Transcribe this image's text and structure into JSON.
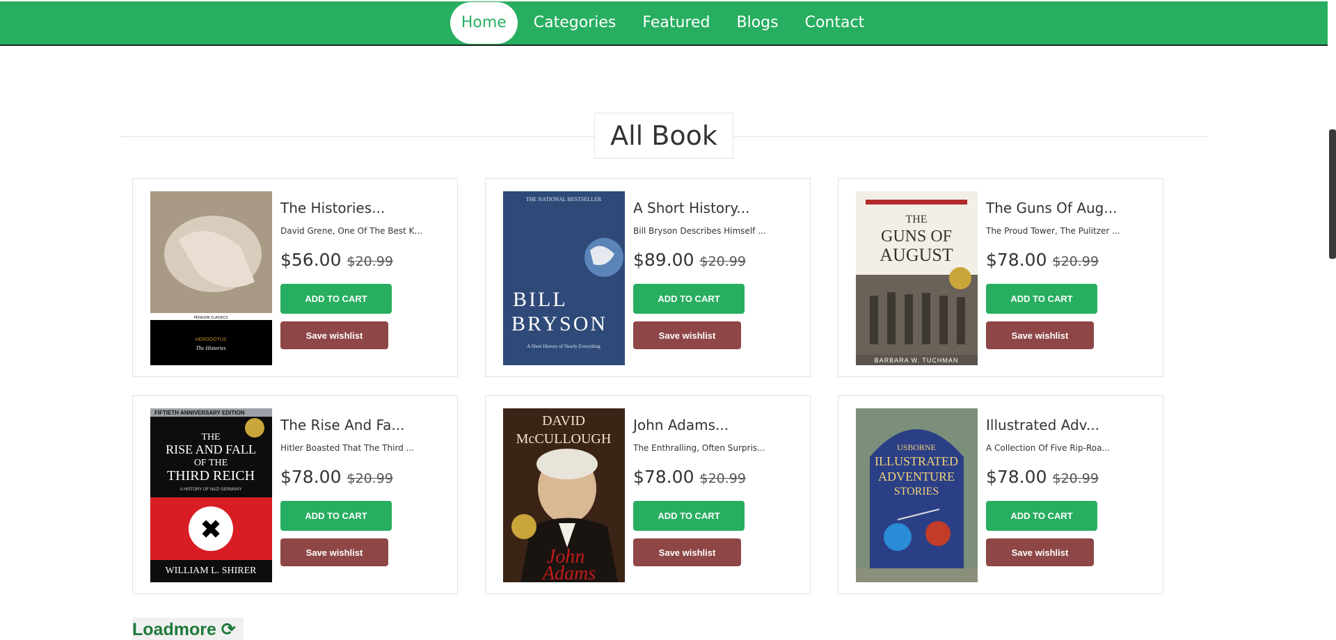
{
  "nav": {
    "items": [
      {
        "label": "Home",
        "active": true
      },
      {
        "label": "Categories",
        "active": false
      },
      {
        "label": "Featured",
        "active": false
      },
      {
        "label": "Blogs",
        "active": false
      },
      {
        "label": "Contact",
        "active": false
      }
    ]
  },
  "section": {
    "title": "All Book"
  },
  "colors": {
    "brand": "#27ae60",
    "wishlist": "#8e4646"
  },
  "books": [
    {
      "title": "The Histories...",
      "desc": "David Grene, One Of The Best K...",
      "price": "$56.00",
      "old_price": "$20.99",
      "cart_label": "ADD TO CART",
      "wish_label": "Save wishlist",
      "cover_text": [
        "PENGUIN CLASSICS",
        "HERODOTUS",
        "The Histories"
      ]
    },
    {
      "title": "A Short History...",
      "desc": "Bill Bryson Describes Himself ...",
      "price": "$89.00",
      "old_price": "$20.99",
      "cart_label": "ADD TO CART",
      "wish_label": "Save wishlist",
      "cover_text": [
        "THE NATIONAL BESTSELLER",
        "BILL",
        "BRYSON",
        "A Short History of Nearly Everything"
      ]
    },
    {
      "title": "The Guns Of Aug...",
      "desc": "The Proud Tower, The Pulitzer ...",
      "price": "$78.00",
      "old_price": "$20.99",
      "cart_label": "ADD TO CART",
      "wish_label": "Save wishlist",
      "cover_text": [
        "THE",
        "GUNS OF",
        "AUGUST",
        "BARBARA W. TUCHMAN"
      ]
    },
    {
      "title": "The Rise And Fa...",
      "desc": "Hitler Boasted That The Third ...",
      "price": "$78.00",
      "old_price": "$20.99",
      "cart_label": "ADD TO CART",
      "wish_label": "Save wishlist",
      "cover_text": [
        "FIFTIETH ANNIVERSARY EDITION",
        "THE",
        "RISE AND FALL",
        "OF THE",
        "THIRD REICH",
        "A HISTORY OF NAZI GERMANY",
        "WILLIAM L. SHIRER"
      ]
    },
    {
      "title": "John Adams...",
      "desc": "The Enthralling, Often Surpris...",
      "price": "$78.00",
      "old_price": "$20.99",
      "cart_label": "ADD TO CART",
      "wish_label": "Save wishlist",
      "cover_text": [
        "DAVID",
        "McCULLOUGH",
        "John",
        "Adams"
      ]
    },
    {
      "title": "Illustrated Adv...",
      "desc": "A Collection Of Five Rip-Roa...",
      "price": "$78.00",
      "old_price": "$20.99",
      "cart_label": "ADD TO CART",
      "wish_label": "Save wishlist",
      "cover_text": [
        "USBORNE",
        "ILLUSTRATED",
        "ADVENTURE",
        "STORIES"
      ]
    }
  ],
  "loadmore": {
    "label": "Loadmore ⟳"
  }
}
